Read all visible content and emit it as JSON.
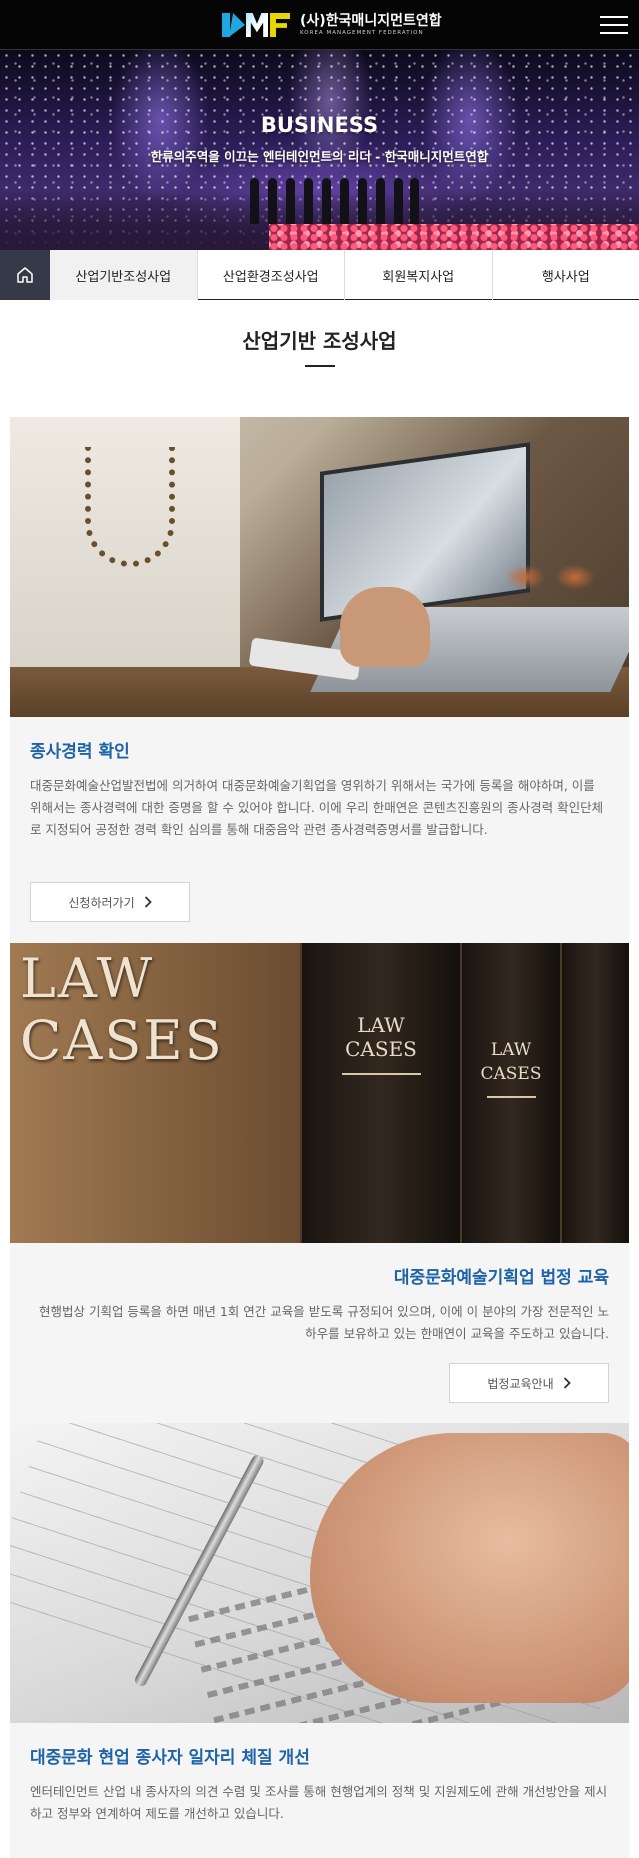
{
  "header": {
    "logo_title": "(사)한국매니지먼트연합",
    "logo_subtitle": "KOREA MANAGEMENT FEDERATION",
    "logo_mark": "KMF",
    "menu_icon": "hamburger-menu-icon"
  },
  "hero": {
    "title": "BUSINESS",
    "subtitle": "한류의주역을 이끄는 엔터테인먼트의 리더 - 한국매니지먼트연합"
  },
  "tabs": {
    "home_icon": "home-icon",
    "items": [
      {
        "label": "산업기반조성사업",
        "active": true
      },
      {
        "label": "산업환경조성사업",
        "active": false
      },
      {
        "label": "회원복지사업",
        "active": false
      },
      {
        "label": "행사사업",
        "active": false
      }
    ]
  },
  "section": {
    "title": "산업기반 조성사업"
  },
  "cards": [
    {
      "title": "종사경력 확인",
      "description": "대중문화예술산업발전법에 의거하여 대중문화예술기획업을 영위하기 위해서는 국가에 등록을 해야하며, 이를 위해서는 종사경력에 대한 증명을 할 수 있어야 합니다. 이에 우리 한매연은 콘텐츠진흥원의 종사경력 확인단체로 지정되어 공정한 경력 확인 심의를 통해 대중음악 관련 종사경력증명서를 발급합니다.",
      "button": "신청하러가기",
      "align": "left"
    },
    {
      "title": "대중문화예술기획업 법정 교육",
      "description": "현행법상 기획업 등록을 하면 매년 1회 연간 교육을 받도록 규정되어 있으며, 이에 이 분야의 가장 전문적인 노하우를 보유하고 있는 한매연이 교육을 주도하고 있습니다.",
      "button": "법정교육안내",
      "align": "right",
      "photo_text": {
        "big": [
          "LAW",
          "CASES"
        ],
        "spine": [
          "LAW",
          "CASES"
        ]
      }
    },
    {
      "title": "대중문화 현업 종사자 일자리 체질 개선",
      "description": "엔터테인먼트 산업 내 종사자의 의견 수렴 및 조사를 통해 현행업계의 정책 및 지원제도에 관해 개선방안을 제시하고 정부와 연계하여 제도를 개선하고 있습니다.",
      "align": "left"
    }
  ],
  "colors": {
    "accent_blue": "#1e63a8",
    "header_bg": "#050505",
    "home_tab_bg": "#363a48",
    "card_bg": "#f5f5f5"
  }
}
